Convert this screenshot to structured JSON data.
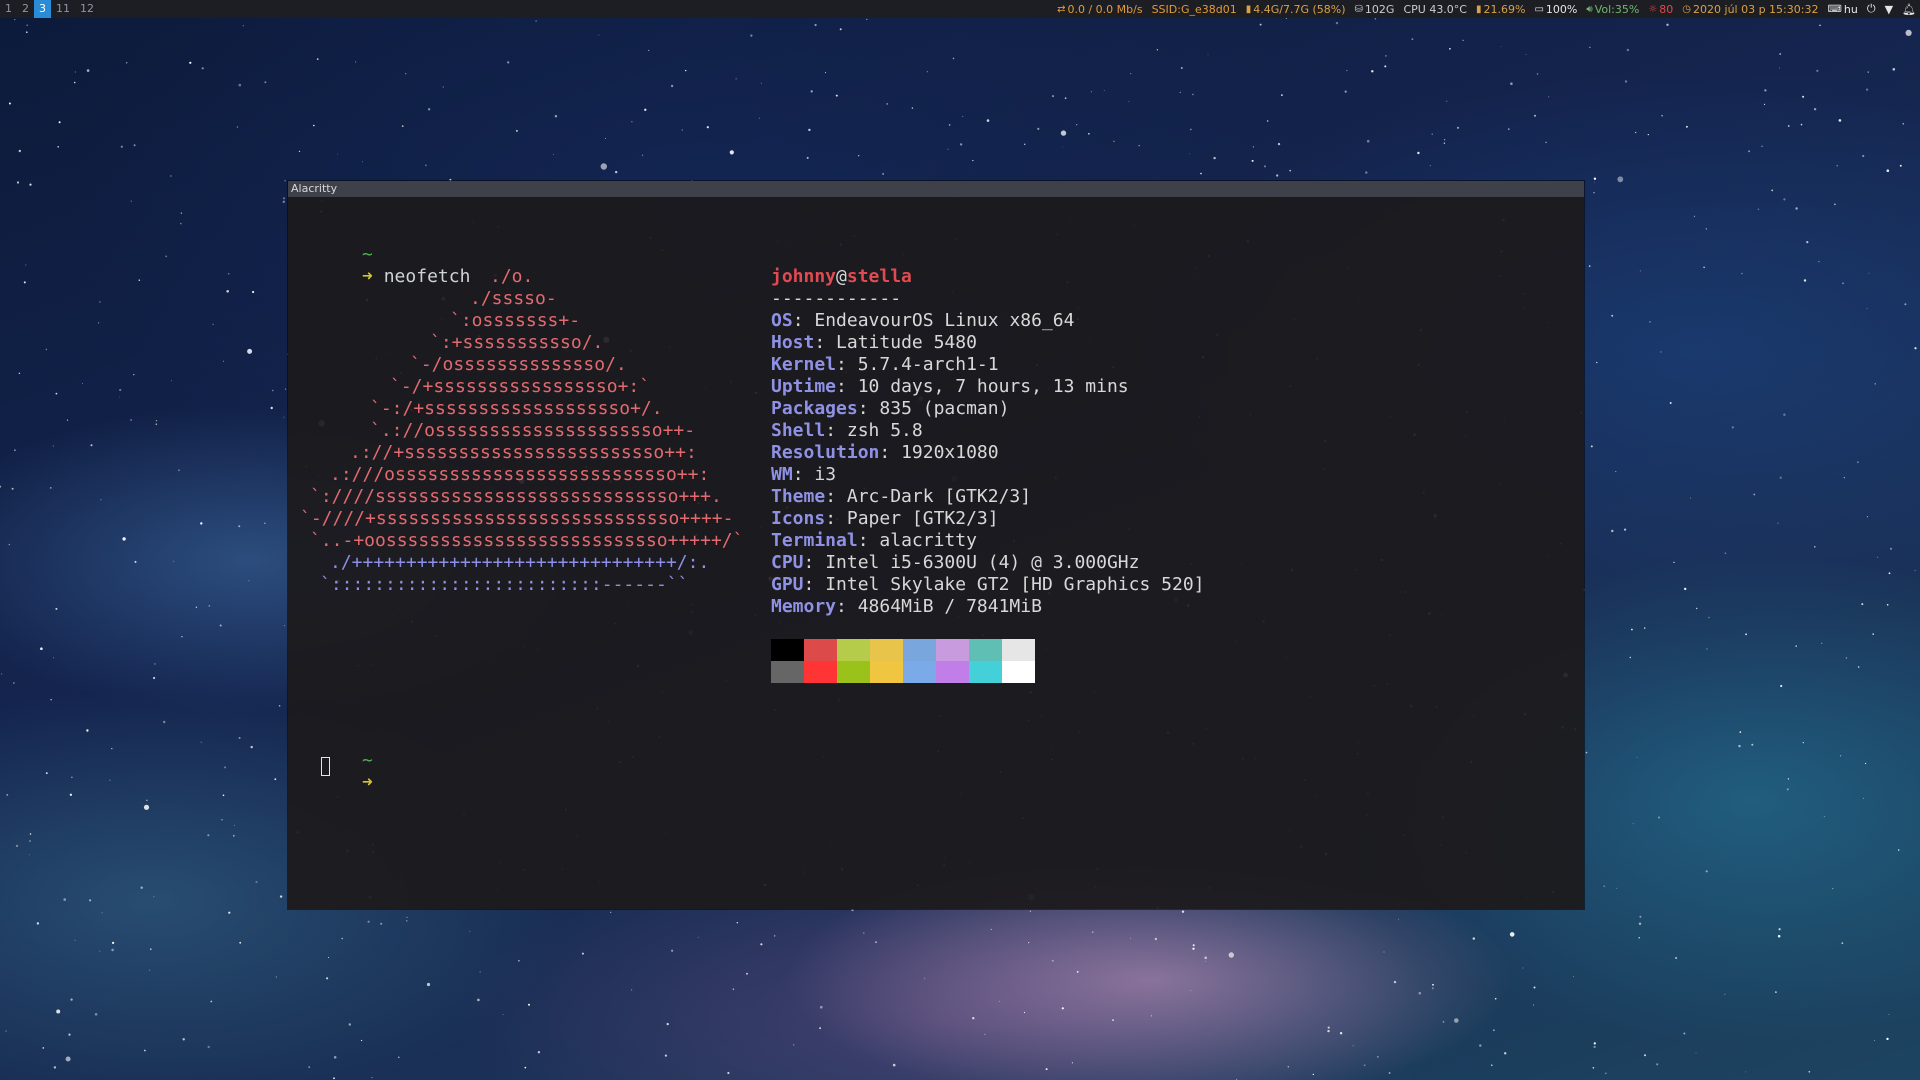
{
  "bar": {
    "workspaces": [
      {
        "label": "1",
        "active": false
      },
      {
        "label": "2",
        "active": false
      },
      {
        "label": "3",
        "active": true
      },
      {
        "label": "11",
        "active": false
      },
      {
        "label": "12",
        "active": false
      }
    ],
    "network": "0.0  /  0.0 Mb/s",
    "ssid": "SSID:G_e38d01",
    "mem": "4.4G/7.7G (58%)",
    "disk": "102G",
    "cpu_temp": "CPU 43.0°C",
    "cpu_usage": "21.69%",
    "battery": "100%",
    "volume": "Vol:35%",
    "brightness": "80",
    "datetime": "2020 júl 03 p 15:30:32",
    "keyboard": "hu",
    "colors": {
      "bar_bg": "#1c1e24",
      "workspace_active": "#2a8bd6"
    }
  },
  "window": {
    "title": "Alacritty",
    "prompt_dir": "~",
    "prompt_arrow": "➜",
    "command": "neofetch",
    "prompt2_dir": "~",
    "prompt2_arrow": "➜"
  },
  "neofetch": {
    "logo": [
      {
        "text": "./o.",
        "style": "logo"
      },
      {
        "text": "./sssso-",
        "style": "logo"
      },
      {
        "text": "`:osssssss+-",
        "style": "logo"
      },
      {
        "text": "`:+sssssssssso/.",
        "style": "logo"
      },
      {
        "text": "`-/ossssssssssssso/.",
        "style": "logo"
      },
      {
        "text": "`-/+sssssssssssssssso+:`",
        "style": "logo"
      },
      {
        "text": "`-:/+sssssssssssssssssso+/.",
        "style": "logo"
      },
      {
        "text": "`.://osssssssssssssssssssso++-",
        "style": "logo"
      },
      {
        "text": ".://+ssssssssssssssssssssssso++:",
        "style": "logo"
      },
      {
        "text": ".:///ossssssssssssssssssssssssso++:",
        "style": "logo"
      },
      {
        "text": "`:////ssssssssssssssssssssssssssso+++.",
        "style": "logo"
      },
      {
        "text": "`-////+ssssssssssssssssssssssssssso++++-",
        "style": "logo"
      },
      {
        "text": "`..-+oossssssssssssssssssssssssso+++++/`",
        "style": "logo"
      },
      {
        "text": "./++++++++++++++++++++++++++++++/:.",
        "style": "logo-b"
      },
      {
        "text": "`:::::::::::::::::::::::::------``",
        "style": "logo-b"
      }
    ],
    "user": "johnny",
    "at": "@",
    "host": "stella",
    "underline": "------------",
    "info": [
      {
        "key": "OS",
        "value": "EndeavourOS Linux x86_64"
      },
      {
        "key": "Host",
        "value": "Latitude 5480"
      },
      {
        "key": "Kernel",
        "value": "5.7.4-arch1-1"
      },
      {
        "key": "Uptime",
        "value": "10 days, 7 hours, 13 mins"
      },
      {
        "key": "Packages",
        "value": "835 (pacman)"
      },
      {
        "key": "Shell",
        "value": "zsh 5.8"
      },
      {
        "key": "Resolution",
        "value": "1920x1080"
      },
      {
        "key": "WM",
        "value": "i3"
      },
      {
        "key": "Theme",
        "value": "Arc-Dark [GTK2/3]"
      },
      {
        "key": "Icons",
        "value": "Paper [GTK2/3]"
      },
      {
        "key": "Terminal",
        "value": "alacritty"
      },
      {
        "key": "CPU",
        "value": "Intel i5-6300U (4) @ 3.000GHz"
      },
      {
        "key": "GPU",
        "value": "Intel Skylake GT2 [HD Graphics 520]"
      },
      {
        "key": "Memory",
        "value": "4864MiB / 7841MiB"
      }
    ],
    "palette": [
      "#000000",
      "#dd4a4a",
      "#b5cc4a",
      "#e8c44a",
      "#78a6dd",
      "#c89ade",
      "#5fbfb5",
      "#e6e6e6",
      "#666666",
      "#ff3434",
      "#9ac21a",
      "#f0c640",
      "#7aaae8",
      "#c17ee8",
      "#44d0d8",
      "#ffffff"
    ]
  }
}
